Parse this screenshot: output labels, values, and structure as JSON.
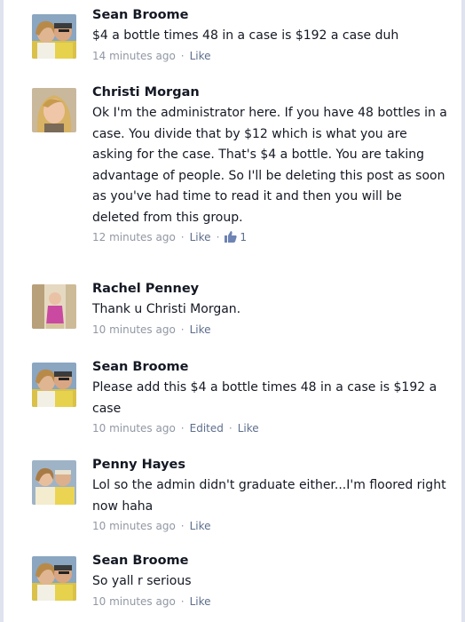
{
  "comments": [
    {
      "author": "Sean Broome",
      "text": "$4 a bottle times 48 in a case is $192 a case duh",
      "time": "14 minutes ago",
      "sep": "·",
      "like_label": "Like"
    },
    {
      "author": "Christi Morgan",
      "text": "Ok I'm the administrator here. If you have 48 bottles in a case. You divide that by $12 which is what you are asking for the case. That's $4 a bottle. You are taking advantage of people. So I'll be deleting this post as soon as you've had time to read it and then you will be deleted from this group.",
      "time": "12 minutes ago",
      "sep": "·",
      "like_label": "Like",
      "sep2": "·",
      "like_count": "1",
      "like_count_icon": "thumbs-up-icon"
    },
    {
      "author": "Rachel Penney",
      "text": "Thank u Christi Morgan.",
      "time": "10 minutes ago",
      "sep": "·",
      "like_label": "Like"
    },
    {
      "author": "Sean Broome",
      "text": "Please add this $4 a bottle times 48 in a case is $192 a case",
      "time": "10 minutes ago",
      "sep": "·",
      "edited_label": "Edited",
      "sep2": "·",
      "like_label": "Like"
    },
    {
      "author": "Penny Hayes",
      "text": "Lol so the admin didn't graduate either...I'm floored right now haha",
      "time": "10 minutes ago",
      "sep": "·",
      "like_label": "Like"
    },
    {
      "author": "Sean Broome",
      "text": "So yall r serious",
      "time": "10 minutes ago",
      "sep": "·",
      "like_label": "Like"
    }
  ],
  "colors": {
    "name": "#141823",
    "meta": "#9197a3",
    "link": "#5d6e8c",
    "frame": "#dfe3ee"
  }
}
